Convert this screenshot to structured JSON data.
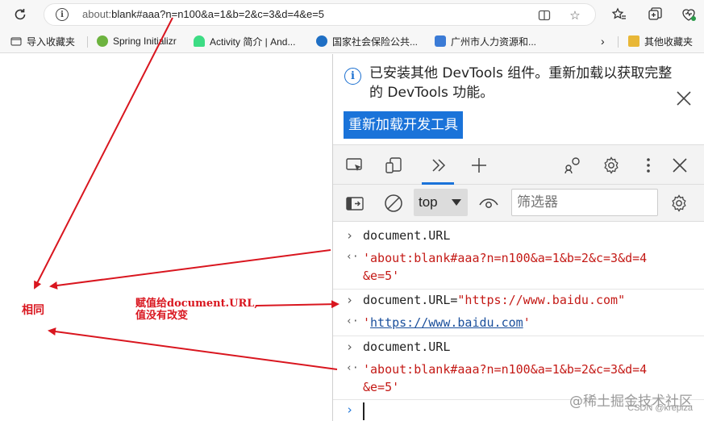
{
  "address": {
    "url_scheme": "about:",
    "url_rest": "blank#aaa?n=n100&a=1&b=2&c=3&d=4&e=5"
  },
  "favorites": [
    {
      "label": "导入收藏夹",
      "color": "#6a6a6a"
    },
    {
      "label": "Spring Initializr",
      "color": "#6db33f"
    },
    {
      "label": "Activity 简介 | And...",
      "color": "#3ddc84"
    },
    {
      "label": "国家社会保险公共...",
      "color": "#1f6fc4"
    },
    {
      "label": "广州市人力资源和...",
      "color": "#3b7bd6"
    },
    {
      "label": "其他收藏夹",
      "color": "#e8b737"
    }
  ],
  "devtools": {
    "notice_text": "已安装其他 DevTools 组件。重新加载以获取完整的 DevTools 功能。",
    "reload_button": "重新加载开发工具",
    "context": "top",
    "filter_placeholder": "筛选器",
    "console": [
      {
        "type": "input",
        "code": "document.URL"
      },
      {
        "type": "output",
        "line1": "'about:blank#aaa?n=n100&a=1&b=2&c=3&d=4",
        "line2": "&e=5'"
      },
      {
        "type": "input",
        "code_prefix": "document.URL=",
        "code_str": "\"https://www.baidu.com\""
      },
      {
        "type": "output",
        "link_q1": "'",
        "link": "https://www.baidu.com",
        "link_q2": "'"
      },
      {
        "type": "input",
        "code": "document.URL"
      },
      {
        "type": "output",
        "line1": "'about:blank#aaa?n=n100&a=1&b=2&c=3&d=4",
        "line2": "&e=5'"
      }
    ]
  },
  "annotations": {
    "same": "相同",
    "assign_line1": "赋值给document.URL,",
    "assign_line2": "值没有改变",
    "accent_color": "#d9161f"
  },
  "watermark": "@稀土掘金技术社区",
  "credit": "CSDN @krepiza"
}
